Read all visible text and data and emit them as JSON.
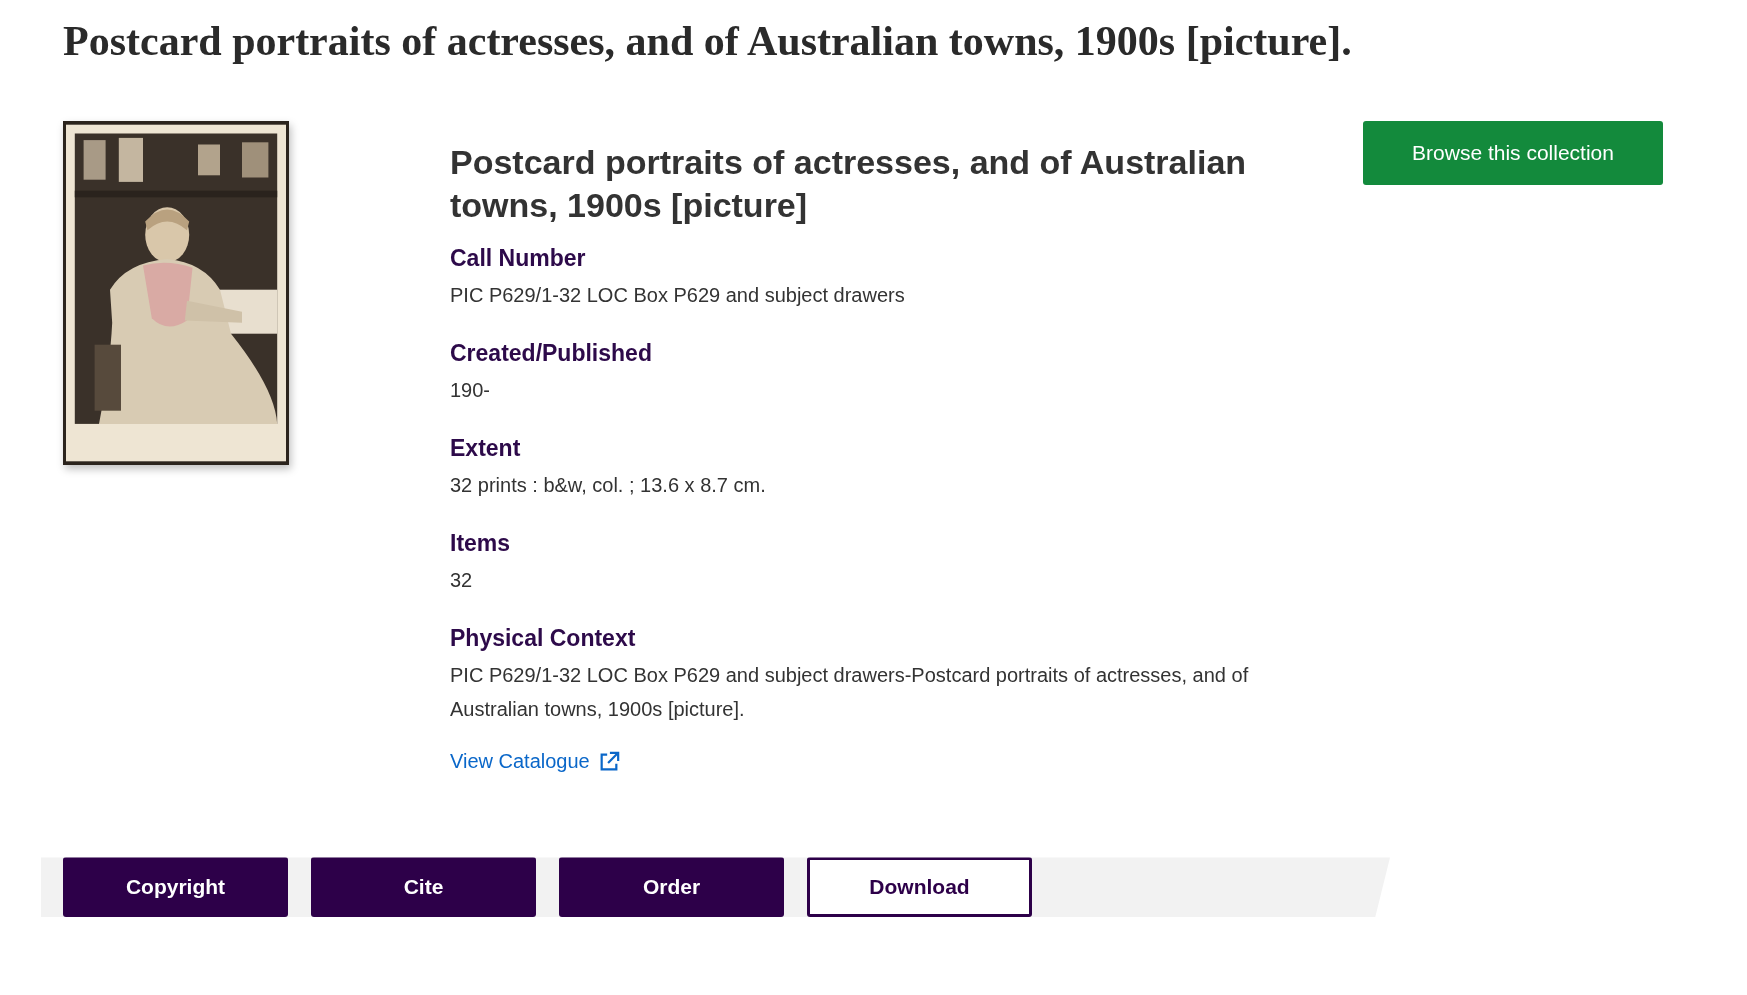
{
  "page_title": "Postcard portraits of actresses, and of Australian towns, 1900s [picture].",
  "record": {
    "heading": "Postcard portraits of actresses, and of Australian towns, 1900s [picture]",
    "fields": [
      {
        "label": "Call Number",
        "value": "PIC P629/1-32 LOC Box P629 and subject drawers"
      },
      {
        "label": "Created/Published",
        "value": "190-"
      },
      {
        "label": "Extent",
        "value": "32 prints : b&w, col. ; 13.6 x 8.7 cm."
      },
      {
        "label": "Items",
        "value": "32"
      },
      {
        "label": "Physical Context",
        "value": "PIC P629/1-32 LOC Box P629 and subject drawers-Postcard portraits of actresses, and of Australian towns, 1900s [picture]."
      }
    ],
    "link": "View Catalogue"
  },
  "browse_button": "Browse this collection",
  "actions": [
    {
      "label": "Copyright",
      "kind": "filled"
    },
    {
      "label": "Cite",
      "kind": "filled"
    },
    {
      "label": "Order",
      "kind": "filled"
    },
    {
      "label": "Download",
      "kind": "outline"
    }
  ]
}
